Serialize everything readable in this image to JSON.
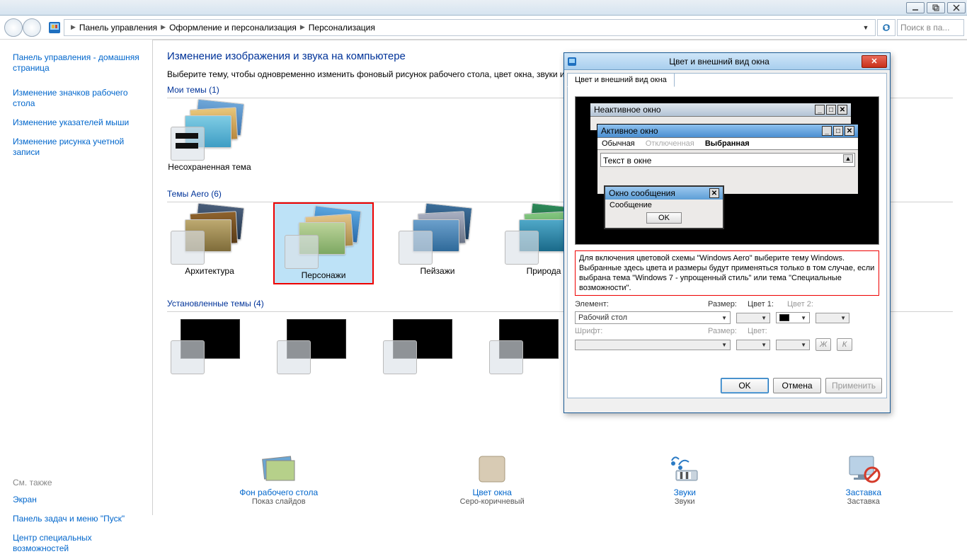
{
  "titlebar": {
    "min": "_",
    "max": "❐",
    "close": "✕"
  },
  "address": {
    "crumbs": [
      "Панель управления",
      "Оформление и персонализация",
      "Персонализация"
    ],
    "search_placeholder": "Поиск в па..."
  },
  "help": "?",
  "sidebar": {
    "home": "Панель управления - домашняя страница",
    "links": [
      "Изменение значков рабочего стола",
      "Изменение указателей мыши",
      "Изменение рисунка учетной записи"
    ],
    "see_also_label": "См. также",
    "see_also": [
      "Экран",
      "Панель задач и меню \"Пуск\"",
      "Центр специальных возможностей"
    ]
  },
  "main": {
    "heading": "Изменение изображения и звука на компьютере",
    "subtext": "Выберите тему, чтобы одновременно изменить фоновый рисунок рабочего стола, цвет окна, звуки и з",
    "sec_my": "Мои темы (1)",
    "theme_unsaved": "Несохраненная тема",
    "sec_aero": "Темы Aero (6)",
    "aero": [
      "Архитектура",
      "Персонажи",
      "Пейзажи",
      "Природа"
    ],
    "sec_installed": "Установленные темы (4)"
  },
  "bottom": [
    {
      "title": "Фон рабочего стола",
      "sub": "Показ слайдов"
    },
    {
      "title": "Цвет окна",
      "sub": "Серо-коричневый"
    },
    {
      "title": "Звуки",
      "sub": "Звуки"
    },
    {
      "title": "Заставка",
      "sub": "Заставка"
    }
  ],
  "dialog": {
    "title": "Цвет и внешний вид окна",
    "tab": "Цвет и внешний вид окна",
    "preview": {
      "inactive": "Неактивное окно",
      "active": "Активное окно",
      "menu_normal": "Обычная",
      "menu_off": "Отключенная",
      "menu_sel": "Выбранная",
      "text_in_window": "Текст в окне",
      "msgbox_title": "Окно сообщения",
      "msgbox_text": "Сообщение",
      "ok": "OK"
    },
    "note": "Для включения цветовой схемы \"Windows Aero\" выберите тему Windows. Выбранные здесь цвета и размеры будут применяться только в том случае, если выбрана тема \"Windows 7 - упрощенный стиль\" или тема \"Специальные возможности\".",
    "labels": {
      "element": "Элемент:",
      "size": "Размер:",
      "color1": "Цвет 1:",
      "color2": "Цвет 2:",
      "font": "Шрифт:",
      "fsize": "Размер:",
      "fcolor": "Цвет:"
    },
    "element_value": "Рабочий стол",
    "bold": "Ж",
    "italic": "К",
    "buttons": {
      "ok": "OK",
      "cancel": "Отмена",
      "apply": "Применить"
    }
  }
}
